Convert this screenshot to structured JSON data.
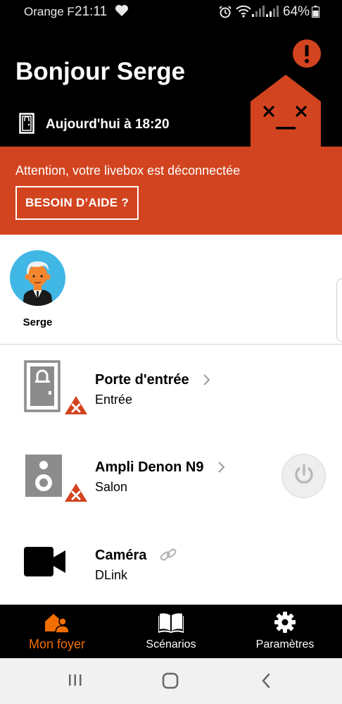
{
  "status_bar": {
    "carrier": "Orange F",
    "time": "21:11",
    "battery": "64%",
    "icons": [
      "heart-icon",
      "alarm-icon",
      "wifi-icon",
      "signal-icon",
      "signal-icon",
      "battery-icon"
    ]
  },
  "header": {
    "greeting": "Bonjour Serge",
    "last_event": "Aujourd'hui à 18:20",
    "status_icon": "door-icon",
    "illustration": "disconnected-house-icon"
  },
  "alert": {
    "message": "Attention, votre livebox est déconnectée",
    "button": "BESOIN D’AIDE ?"
  },
  "members": [
    {
      "name": "Serge"
    }
  ],
  "devices": [
    {
      "name": "Porte d'entrée",
      "room": "Entrée",
      "icon": "door-icon",
      "status": "error"
    },
    {
      "name": "Ampli Denon N9",
      "room": "Salon",
      "icon": "speaker-icon",
      "status": "error"
    },
    {
      "name": "Caméra",
      "room": "DLink",
      "icon": "camera-icon",
      "status": "link"
    }
  ],
  "bottom_nav": [
    {
      "label": "Mon foyer",
      "icon": "home-people-icon",
      "active": true
    },
    {
      "label": "Scénarios",
      "icon": "book-icon",
      "active": false
    },
    {
      "label": "Paramètres",
      "icon": "gear-icon",
      "active": false
    }
  ],
  "colors": {
    "accent_orange": "#f16e00",
    "alert_red": "#d2441f",
    "header_bg": "#000000"
  }
}
